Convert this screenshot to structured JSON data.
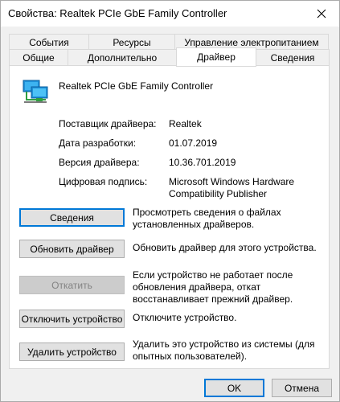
{
  "window": {
    "title": "Свойства: Realtek PCIe GbE Family Controller",
    "close_icon": "close-icon"
  },
  "tabs": {
    "back_row": [
      {
        "label": "События"
      },
      {
        "label": "Ресурсы"
      },
      {
        "label": "Управление электропитанием"
      }
    ],
    "front_row": [
      {
        "label": "Общие"
      },
      {
        "label": "Дополнительно"
      },
      {
        "label": "Драйвер",
        "active": true
      },
      {
        "label": "Сведения"
      }
    ]
  },
  "device": {
    "icon": "network-adapter-icon",
    "name": "Realtek PCIe GbE Family Controller"
  },
  "info": {
    "provider_label": "Поставщик драйвера:",
    "provider_value": "Realtek",
    "date_label": "Дата разработки:",
    "date_value": "01.07.2019",
    "version_label": "Версия драйвера:",
    "version_value": "10.36.701.2019",
    "signature_label": "Цифровая подпись:",
    "signature_value_line1": "Microsoft Windows Hardware",
    "signature_value_line2": "Compatibility Publisher"
  },
  "actions": {
    "details_label": "Сведения",
    "details_desc": "Просмотреть сведения о файлах установленных драйверов.",
    "update_label": "Обновить драйвер",
    "update_desc": "Обновить драйвер для этого устройства.",
    "rollback_label": "Откатить",
    "rollback_desc": "Если устройство не работает после обновления драйвера, откат восстанавливает прежний драйвер.",
    "disable_label": "Отключить устройство",
    "disable_desc": "Отключите устройство.",
    "uninstall_label": "Удалить устройство",
    "uninstall_desc": "Удалить это устройство из системы (для опытных пользователей)."
  },
  "footer": {
    "ok_label": "OK",
    "cancel_label": "Отмена"
  },
  "colors": {
    "accent": "#0078d7",
    "dialog_bg": "#f0f0f0",
    "panel_bg": "#ffffff"
  }
}
